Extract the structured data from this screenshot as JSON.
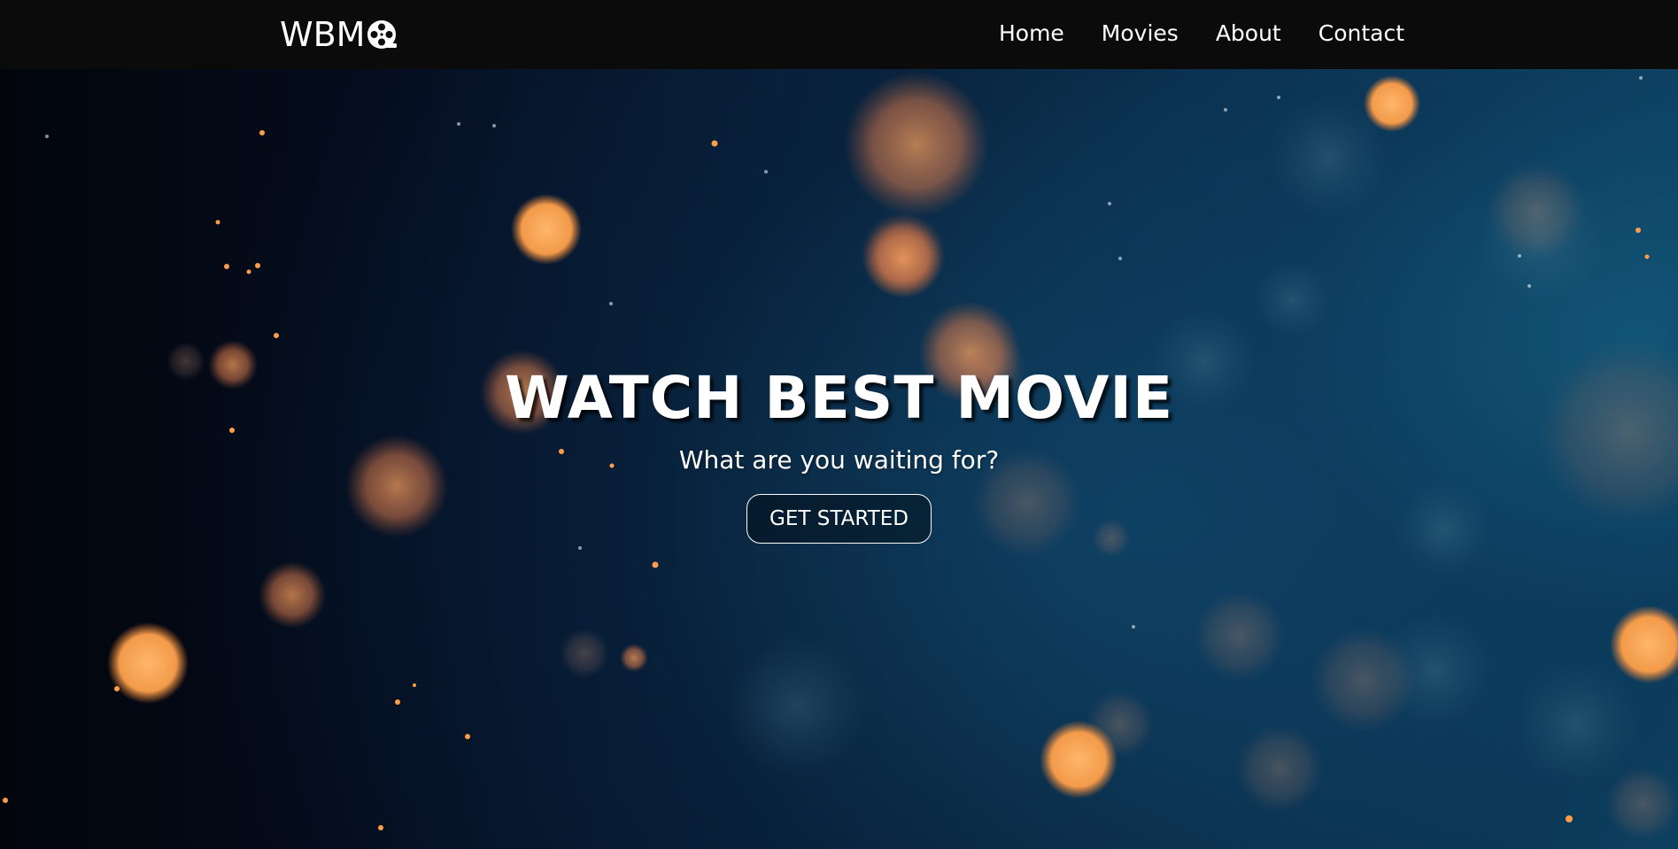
{
  "navbar": {
    "logo_text": "WBM",
    "logo_icon": "film-reel-icon",
    "links": [
      {
        "label": "Home"
      },
      {
        "label": "Movies"
      },
      {
        "label": "About"
      },
      {
        "label": "Contact"
      }
    ]
  },
  "hero": {
    "title": "WATCH BEST MOVIE",
    "subtitle": "What are you waiting for?",
    "cta_label": "GET STARTED"
  },
  "colors": {
    "navbar_bg": "#0b0b0b",
    "text": "#ffffff",
    "bokeh_orange": "#f0a050",
    "hero_dark": "#02050c",
    "hero_teal": "#11506f"
  }
}
